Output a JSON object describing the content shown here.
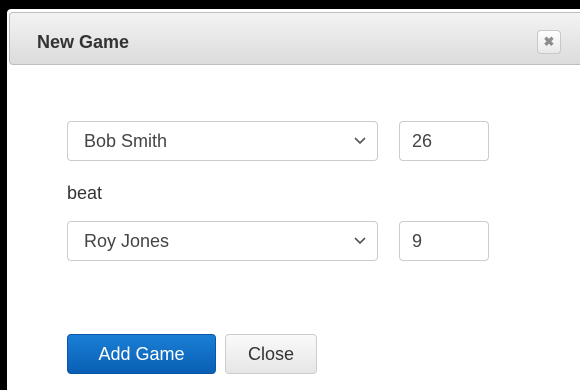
{
  "dialog": {
    "title": "New Game",
    "close_icon": "close-x-icon"
  },
  "form": {
    "winner": {
      "selected": "Bob Smith",
      "score": "26"
    },
    "connector_text": "beat",
    "loser": {
      "selected": "Roy Jones",
      "score": "9"
    }
  },
  "buttons": {
    "add_label": "Add Game",
    "close_label": "Close"
  },
  "colors": {
    "primary": "#0a6cc4",
    "dialog_header": "#e8e8e8"
  }
}
